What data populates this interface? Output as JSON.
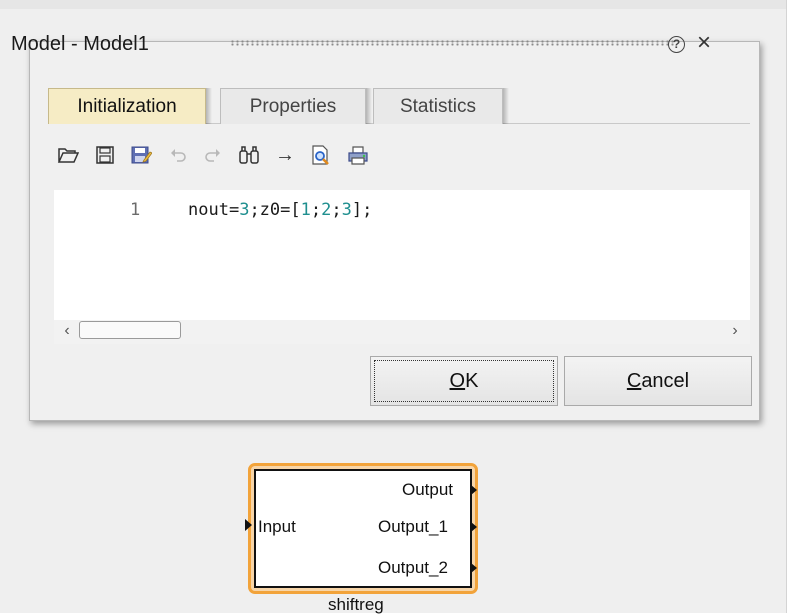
{
  "dialog": {
    "title": "Model - Model1",
    "help_icon": "?",
    "close_icon": "×"
  },
  "tabs": [
    {
      "label": "Initialization",
      "active": true
    },
    {
      "label": "Properties",
      "active": false
    },
    {
      "label": "Statistics",
      "active": false
    }
  ],
  "toolbar": {
    "icons": [
      "open-folder-icon",
      "save-icon",
      "save-as-icon",
      "undo-icon",
      "redo-icon",
      "find-icon",
      "goto-icon",
      "print-preview-icon",
      "print-icon"
    ],
    "goto_glyph": "→"
  },
  "editor": {
    "line_number": "1",
    "code_parts": [
      "nout=",
      "3",
      ";z0=[",
      "1",
      ";",
      "2",
      ";",
      "3",
      "];"
    ]
  },
  "scrollbar": {
    "left_arrow": "‹",
    "right_arrow": "›"
  },
  "buttons": {
    "ok_mnemonic": "O",
    "ok_rest": "K",
    "cancel_mnemonic": "C",
    "cancel_rest": "ancel"
  },
  "block": {
    "name": "shiftreg",
    "inputs": [
      "Input"
    ],
    "outputs": [
      "Output",
      "Output_1",
      "Output_2"
    ]
  },
  "colors": {
    "block_highlight": "#f2a33a",
    "active_tab": "#f6ecc5",
    "code_number": "#1f8f8f"
  }
}
